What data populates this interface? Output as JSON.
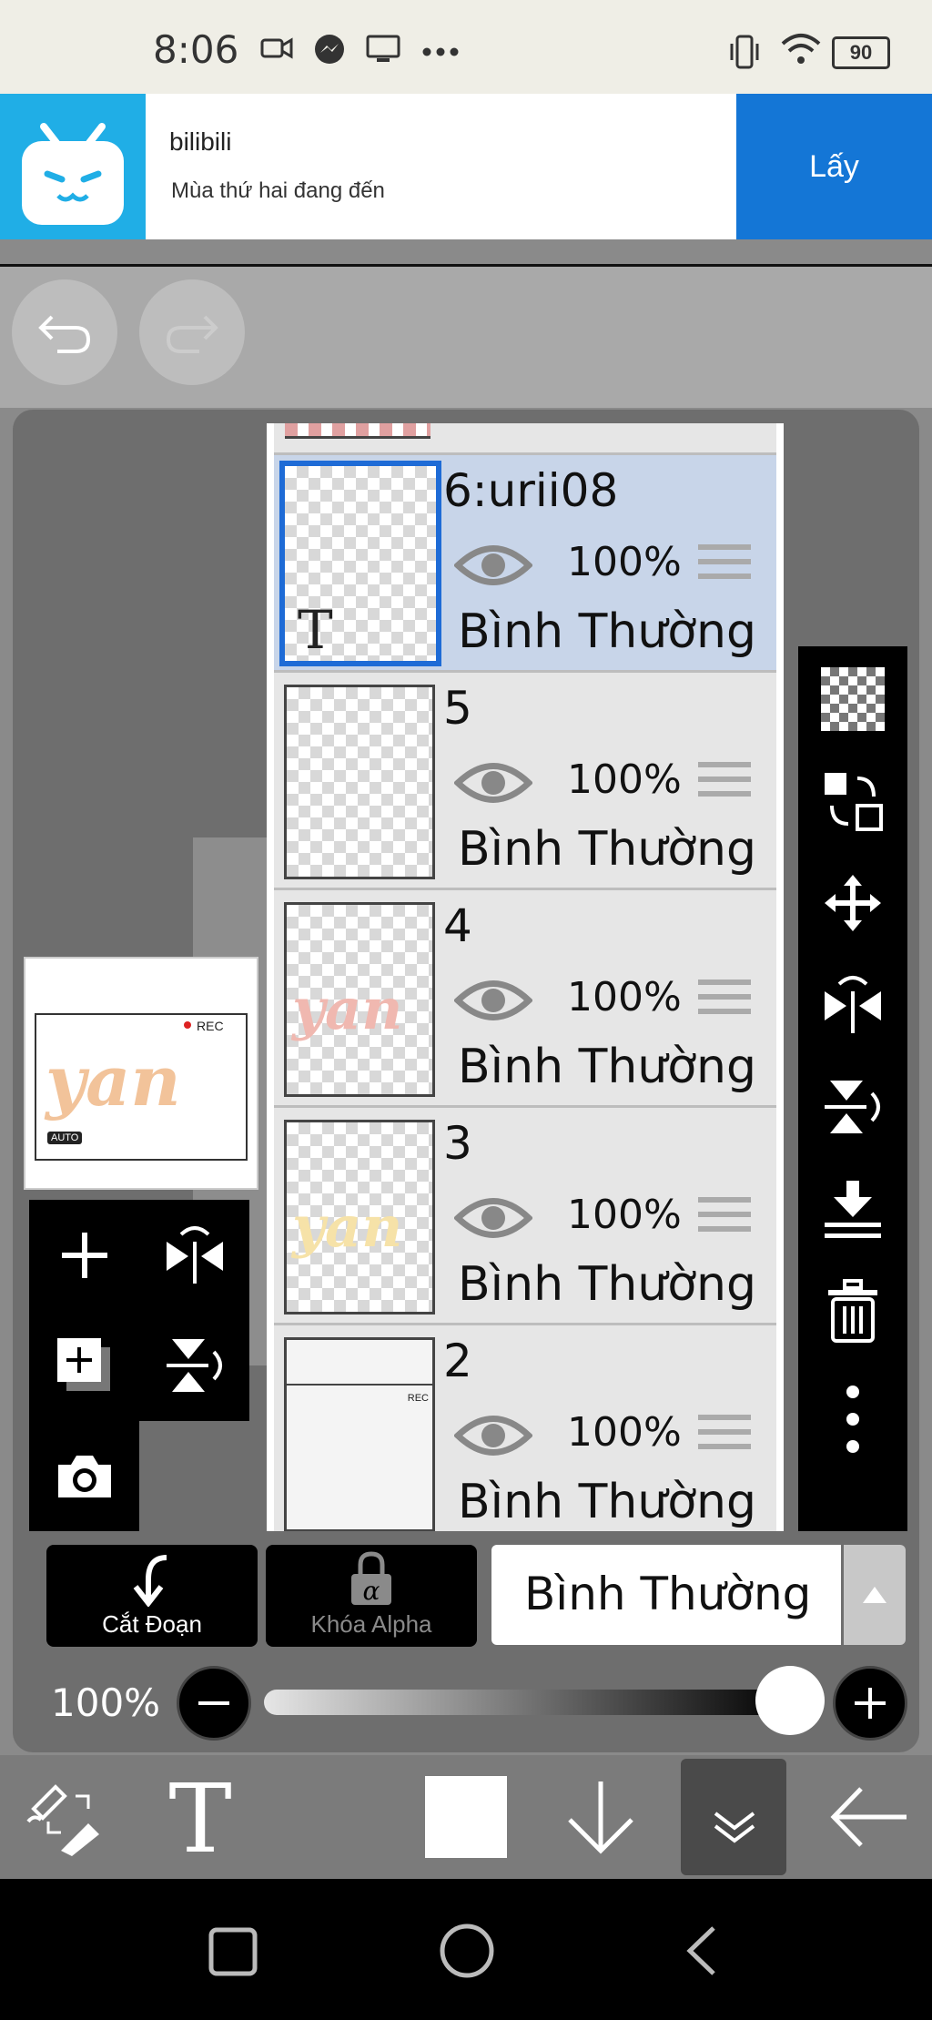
{
  "status_bar": {
    "time": "8:06",
    "battery": "90"
  },
  "ad": {
    "title": "bilibili",
    "subtitle": "Mùa thứ hai đang đến",
    "button": "Lấy"
  },
  "layers": [
    {
      "name": "6:urii08",
      "opacity": "100%",
      "blend": "Bình Thường",
      "selected": true,
      "thumb_text": "T"
    },
    {
      "name": "5",
      "opacity": "100%",
      "blend": "Bình Thường"
    },
    {
      "name": "4",
      "opacity": "100%",
      "blend": "Bình Thường",
      "thumb_text": "yan"
    },
    {
      "name": "3",
      "opacity": "100%",
      "blend": "Bình Thường",
      "thumb_text": "yan"
    },
    {
      "name": "2",
      "opacity": "100%",
      "blend": "Bình Thường",
      "thumb_text": "REC"
    }
  ],
  "preview": {
    "art_text": "yan",
    "rec": "REC",
    "auto": "AUTO"
  },
  "bottom": {
    "cut_label": "Cắt Đoạn",
    "alpha_label": "Khóa Alpha",
    "blend_mode": "Bình Thường",
    "opacity_label": "100%",
    "opacity_value": 1.0
  },
  "colors": {
    "selected_layer": "#c8d5e9",
    "selection_border": "#1e6bd6",
    "ad_button": "#1476d6"
  }
}
